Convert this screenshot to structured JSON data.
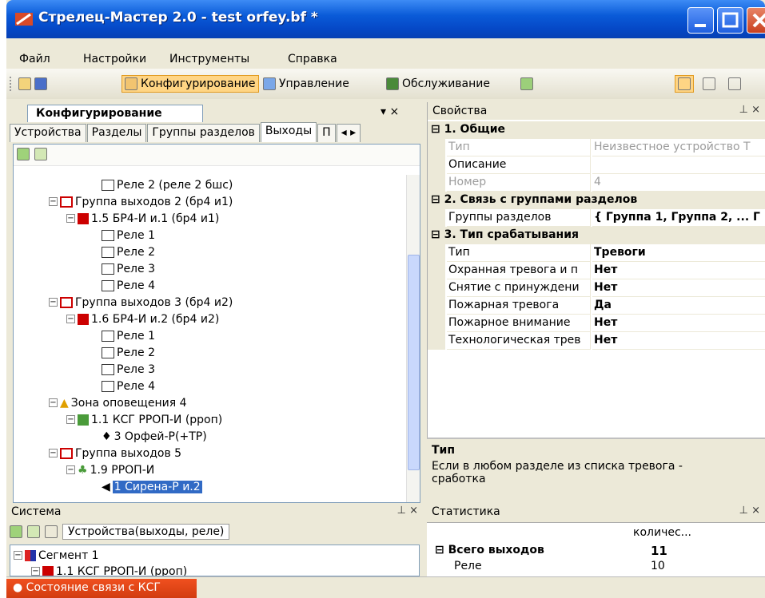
{
  "window": {
    "title": "Стрелец-Мастер 2.0 - test orfey.bf *"
  },
  "menu": [
    "Файл",
    "Настройки",
    "Инструменты",
    "Справка"
  ],
  "toolbar": {
    "cfg": "Конфигурирование",
    "mgmt": "Управление",
    "service": "Обслуживание"
  },
  "left_panel": {
    "title": "Конфигурирование",
    "close": "▾ ×",
    "tabs": [
      "Устройства",
      "Разделы",
      "Группы разделов",
      "Выходы",
      "П"
    ],
    "tree": [
      "Реле 2 (реле 2 бшс)",
      "Группа выходов 2 (бр4 и1)",
      "1.5 БР4-И и.1 (бр4 и1)",
      "Реле 1",
      "Реле 2",
      "Реле 3",
      "Реле 4",
      "Группа выходов 3 (бр4 и2)",
      "1.6 БР4-И и.2 (бр4 и2)",
      "Реле 1",
      "Реле 2",
      "Реле 3",
      "Реле 4",
      "Зона оповещения 4",
      "1.1 КСГ РРОП-И (рроп)",
      "3 Орфей-Р(+ТР)",
      "Группа выходов 5",
      "1.9 РРОП-И",
      "1 Сирена-Р и.2"
    ]
  },
  "props": {
    "title": "Свойства",
    "cat1": "1. Общие",
    "type_l": "Тип",
    "type_v": "Неизвестное устройство Т",
    "desc_l": "Описание",
    "num_l": "Номер",
    "num_v": "4",
    "cat2": "2. Связь с группами разделов",
    "grp_l": "Группы разделов",
    "grp_v": "{ Группа 1, Группа 2, ... Г",
    "cat3": "3. Тип срабатывания",
    "t_l": "Тип",
    "t_v": "Тревоги",
    "r1_l": "Охранная тревога и п",
    "r1_v": "Нет",
    "r2_l": "Снятие с принуждени",
    "r2_v": "Нет",
    "r3_l": "Пожарная тревога",
    "r3_v": "Да",
    "r4_l": "Пожарное внимание",
    "r4_v": "Нет",
    "r5_l": "Технологическая трев",
    "r5_v": "Нет"
  },
  "help": {
    "title": "Тип",
    "text": "Если в любом разделе из списка тревога - сработка"
  },
  "system": {
    "title": "Система",
    "filter": "Устройства(выходы, реле)",
    "seg": "Сегмент 1",
    "sub": "1.1 КСГ РРОП-И (рроп)"
  },
  "stats": {
    "title": "Статистика",
    "col": "количес...",
    "total_l": "Всего выходов",
    "total_v": "11",
    "relay_l": "Реле",
    "relay_v": "10"
  },
  "status": {
    "text": "Состояние связи с КСГ"
  }
}
